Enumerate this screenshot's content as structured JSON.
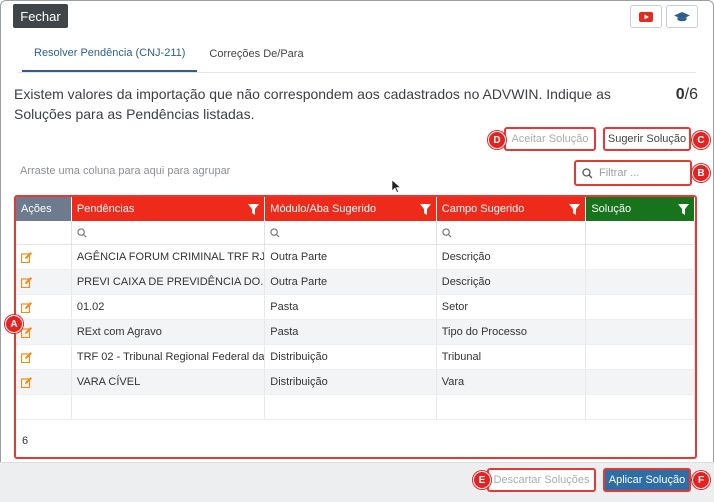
{
  "header": {
    "close_label": "Fechar",
    "icons": [
      "youtube-icon",
      "graduation-cap-icon"
    ]
  },
  "tabs": [
    {
      "label": "Resolver Pendência (CNJ-211)",
      "active": true
    },
    {
      "label": "Correções De/Para",
      "active": false
    }
  ],
  "description": "Existem valores da importação que não correspondem aos cadastrados no ADVWIN. Indique as Soluções para as Pendências listadas.",
  "progress": {
    "done": "0",
    "total": "/6"
  },
  "actions": {
    "accept": "Aceitar Solução",
    "suggest": "Sugerir Solução"
  },
  "group_hint": "Arraste uma coluna para aqui para agrupar",
  "filter": {
    "placeholder": "Filtrar ..."
  },
  "grid": {
    "columns": [
      "Ações",
      "Pendências",
      "Módulo/Aba Sugerido",
      "Campo Sugerido",
      "Solução"
    ],
    "rows": [
      {
        "pendencia": "AGÊNCIA FORUM CRIMINAL TRF RJ",
        "modulo": "Outra Parte",
        "campo": "Descrição",
        "solucao": ""
      },
      {
        "pendencia": "PREVI CAIXA DE PREVIDÊNCIA DO...",
        "modulo": "Outra Parte",
        "campo": "Descrição",
        "solucao": ""
      },
      {
        "pendencia": "01.02",
        "modulo": "Pasta",
        "campo": "Setor",
        "solucao": ""
      },
      {
        "pendencia": "RExt com Agravo",
        "modulo": "Pasta",
        "campo": "Tipo do Processo",
        "solucao": ""
      },
      {
        "pendencia": "TRF 02 - Tribunal Regional Federal da...",
        "modulo": "Distribuição",
        "campo": "Tribunal",
        "solucao": ""
      },
      {
        "pendencia": "VARA CÍVEL",
        "modulo": "Distribuição",
        "campo": "Vara",
        "solucao": ""
      }
    ],
    "footer_count": "6"
  },
  "bottom": {
    "discard": "Descartar Soluções",
    "apply": "Aplicar Solução"
  },
  "callouts": {
    "a": "A",
    "b": "B",
    "c": "C",
    "d": "D",
    "e": "E",
    "f": "F"
  },
  "colors": {
    "header_red": "#ee2b1b",
    "header_green": "#17741d",
    "header_gray": "#6d7b8f",
    "primary": "#2f6ea5",
    "callout": "#e52222"
  }
}
